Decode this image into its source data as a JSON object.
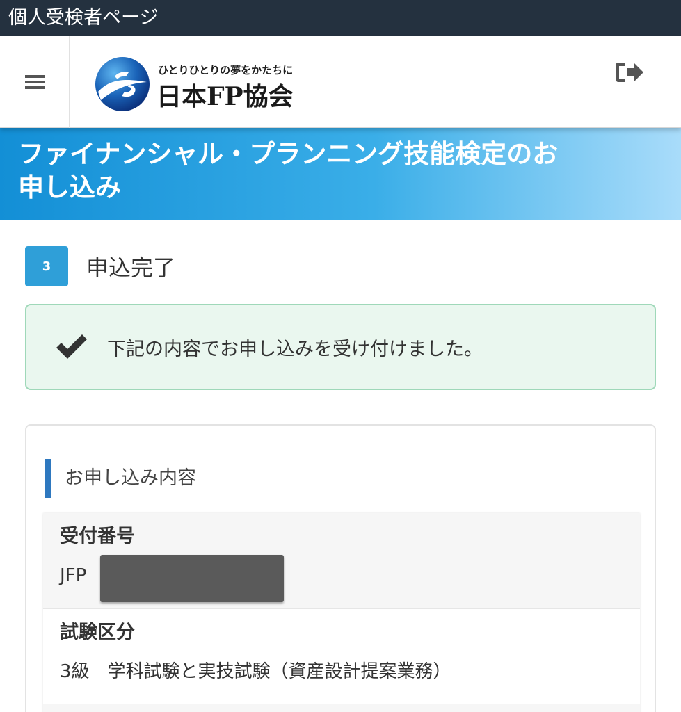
{
  "topbar": {
    "title": "個人受検者ページ"
  },
  "header": {
    "menu_icon": "hamburger-menu-icon",
    "logout_icon": "sign-out-icon",
    "logo": {
      "tagline": "ひとりひとりの夢をかたちに",
      "name": "日本FP協会"
    }
  },
  "banner": {
    "title": "ファイナンシャル・プランニング技能検定のお申し込み"
  },
  "step": {
    "number": "3",
    "label": "申込完了"
  },
  "alert": {
    "icon": "checkmark-icon",
    "message": "下記の内容でお申し込みを受け付けました。"
  },
  "details": {
    "section_title": "お申し込み内容",
    "items": [
      {
        "label": "受付番号",
        "value": "JFP"
      },
      {
        "label": "試験区分",
        "value": "3級　学科試験と実技試験（資産設計提案業務）"
      }
    ]
  },
  "colors": {
    "topbar": "#24313f",
    "step_badge": "#2f9fd8",
    "alert_bg": "#eaf7ef",
    "alert_border": "#9fd8b9",
    "section_accent": "#2e78bf"
  }
}
